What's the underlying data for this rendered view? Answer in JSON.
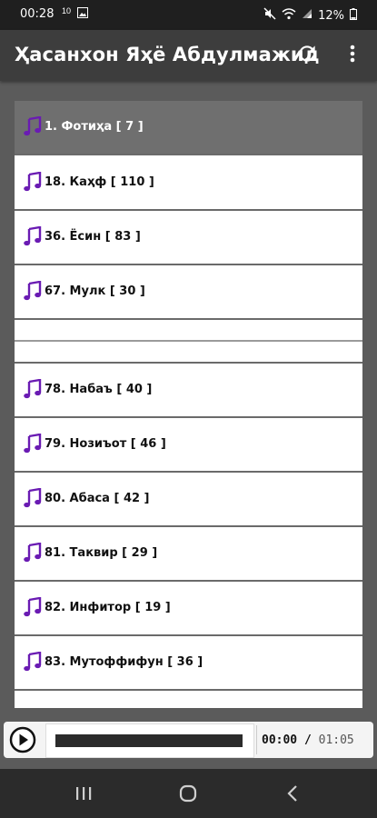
{
  "status_bar": {
    "time": "00:28",
    "notif_icons": [
      "10",
      "image"
    ],
    "battery": "12%"
  },
  "app_bar": {
    "title": "Ҳасанхон Яҳё Абдулмажид",
    "icons": [
      "refresh-icon",
      "more-vert-icon"
    ]
  },
  "list": {
    "items": [
      {
        "label": "1. Фотиҳа [ 7 ]",
        "selected": true
      },
      {
        "label": "18. Каҳф [ 110 ]"
      },
      {
        "label": "36. Ёсин [ 83 ]"
      },
      {
        "label": "67. Мулк [ 30 ]"
      },
      {
        "label": "78. Набаъ [ 40 ]"
      },
      {
        "label": "79. Нозиъот [ 46 ]"
      },
      {
        "label": "80. Абаса [ 42 ]"
      },
      {
        "label": "81. Таквир [ 29 ]"
      },
      {
        "label": "82. Инфитор [ 19 ]"
      },
      {
        "label": "83. Мутоффифун [ 36 ]"
      }
    ],
    "icon": "music-note-icon",
    "accent_color": "#6a1bb3"
  },
  "player": {
    "current_time": "00:00",
    "separator": "/",
    "total_time": "01:05",
    "progress": 0
  },
  "nav_bar": {
    "icons": [
      "recents-icon",
      "home-icon",
      "back-icon"
    ]
  }
}
